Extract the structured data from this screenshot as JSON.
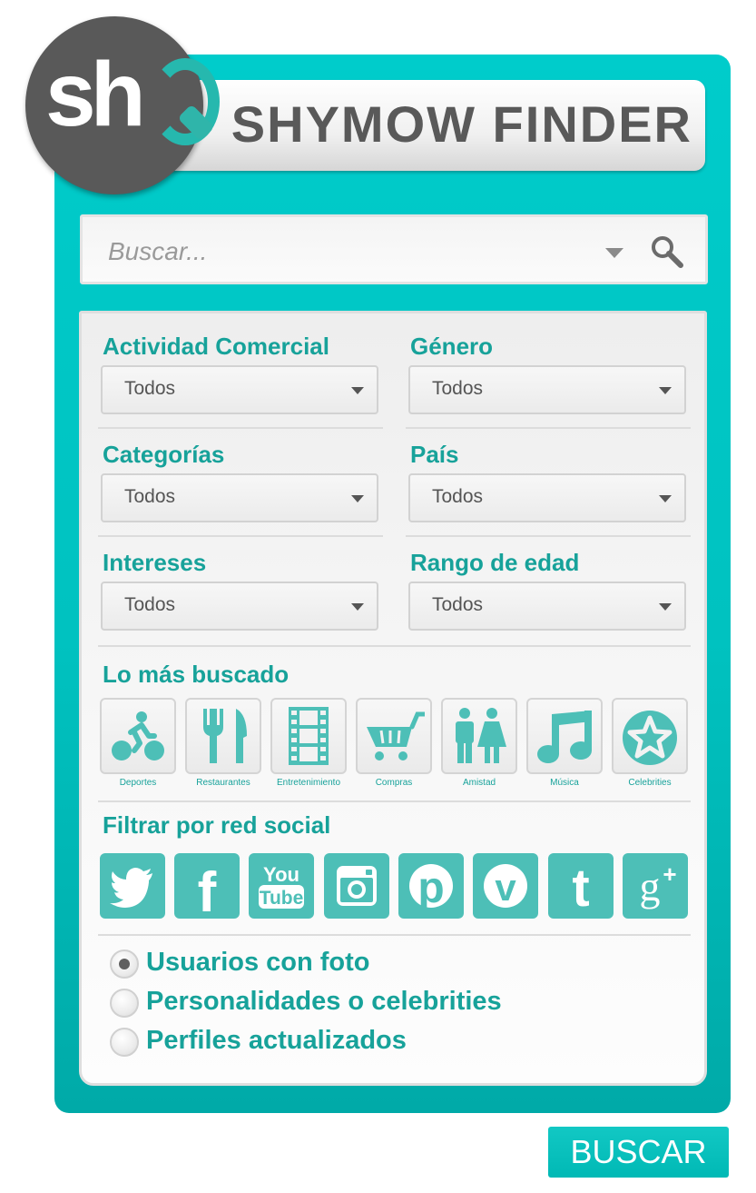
{
  "brand": {
    "logo_text": "sh",
    "title": "SHYMOW FINDER",
    "accent_color": "#17a29a",
    "frame_color": "#00cccb"
  },
  "search": {
    "placeholder": "Buscar...",
    "value": ""
  },
  "filters": [
    {
      "label": "Actividad Comercial",
      "value": "Todos"
    },
    {
      "label": "Género",
      "value": "Todos"
    },
    {
      "label": "Categorías",
      "value": "Todos"
    },
    {
      "label": "País",
      "value": "Todos"
    },
    {
      "label": "Intereses",
      "value": "Todos"
    },
    {
      "label": "Rango de edad",
      "value": "Todos"
    }
  ],
  "popular": {
    "title": "Lo más buscado",
    "items": [
      {
        "label": "Deportes",
        "icon": "cyclist-icon"
      },
      {
        "label": "Restaurantes",
        "icon": "fork-knife-icon"
      },
      {
        "label": "Entretenimiento",
        "icon": "film-strip-icon"
      },
      {
        "label": "Compras",
        "icon": "shopping-cart-icon"
      },
      {
        "label": "Amistad",
        "icon": "people-icon"
      },
      {
        "label": "Música",
        "icon": "music-note-icon"
      },
      {
        "label": "Celebrities",
        "icon": "star-icon"
      }
    ]
  },
  "social": {
    "title": "Filtrar por red social",
    "networks": [
      {
        "name": "twitter",
        "icon": "twitter-icon"
      },
      {
        "name": "facebook",
        "icon": "facebook-icon",
        "glyph": "f"
      },
      {
        "name": "youtube",
        "icon": "youtube-icon",
        "glyph_top": "You",
        "glyph_bottom": "Tube"
      },
      {
        "name": "instagram",
        "icon": "instagram-icon"
      },
      {
        "name": "pinterest",
        "icon": "pinterest-icon",
        "glyph": "p"
      },
      {
        "name": "vine",
        "icon": "vine-icon",
        "glyph": "v"
      },
      {
        "name": "tumblr",
        "icon": "tumblr-icon",
        "glyph": "t"
      },
      {
        "name": "google-plus",
        "icon": "google-plus-icon",
        "glyph": "g",
        "glyph_plus": "+"
      }
    ]
  },
  "options": [
    {
      "label": "Usuarios con foto",
      "checked": true
    },
    {
      "label": "Personalidades o celebrities",
      "checked": false
    },
    {
      "label": "Perfiles actualizados",
      "checked": false
    }
  ],
  "submit_label": "BUSCAR"
}
